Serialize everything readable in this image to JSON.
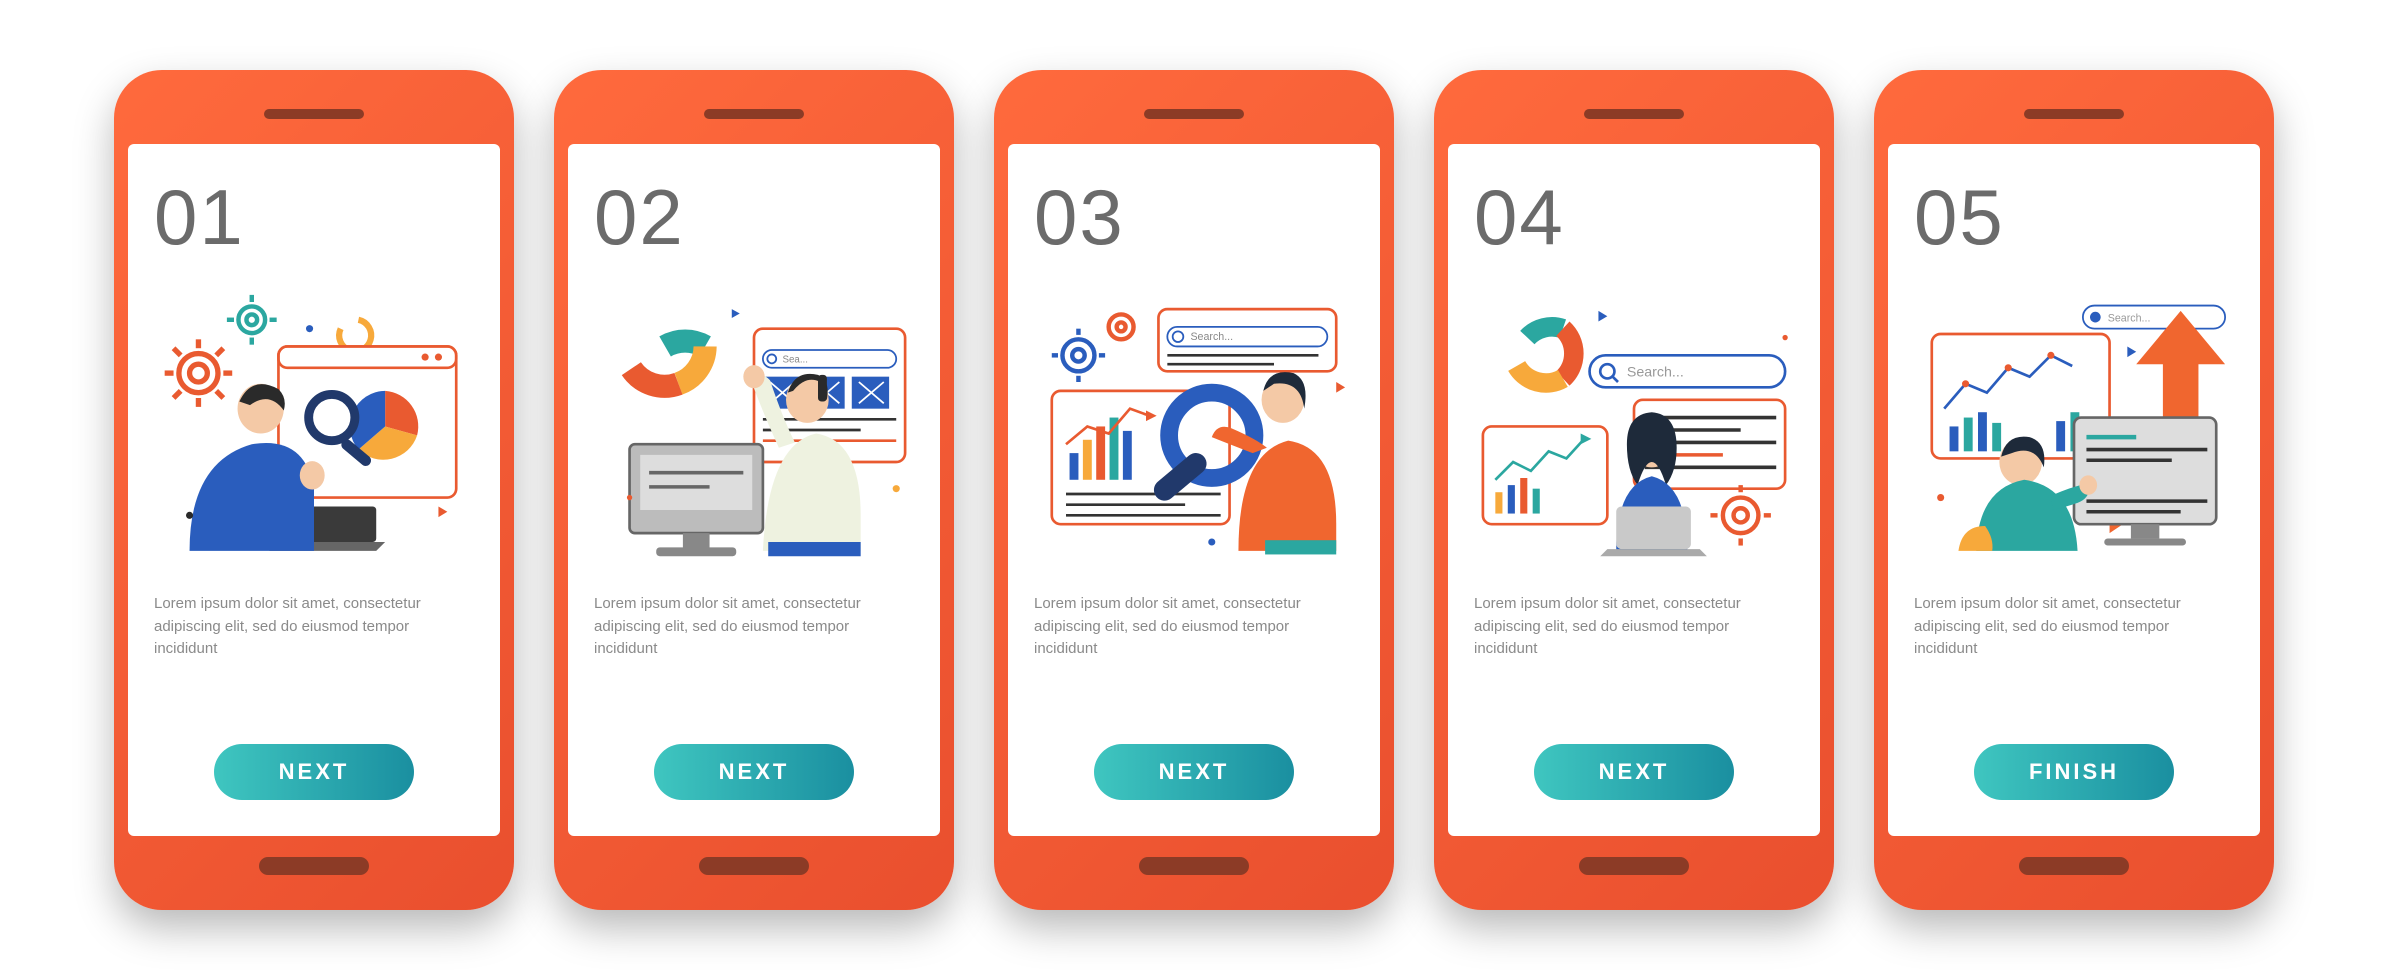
{
  "colors": {
    "phone_grad_a": "#ff6a3d",
    "phone_grad_b": "#e94f2e",
    "btn_grad_a": "#3fc6c0",
    "btn_grad_b": "#1a8fa0",
    "blue": "#2a5dbd",
    "teal": "#2ba7a0",
    "orange": "#f0662f",
    "amber": "#f7a93b"
  },
  "screens": [
    {
      "number": "01",
      "desc": "Lorem ipsum dolor sit amet, consectetur adipiscing elit, sed do eiusmod tempor incididunt",
      "button": "NEXT"
    },
    {
      "number": "02",
      "desc": "Lorem ipsum dolor sit amet, consectetur adipiscing elit, sed do eiusmod tempor incididunt",
      "button": "NEXT"
    },
    {
      "number": "03",
      "desc": "Lorem ipsum dolor sit amet, consectetur adipiscing elit, sed do eiusmod tempor incididunt",
      "button": "NEXT",
      "search_placeholder": "Search..."
    },
    {
      "number": "04",
      "desc": "Lorem ipsum dolor sit amet, consectetur adipiscing elit, sed do eiusmod tempor incididunt",
      "button": "NEXT",
      "search_placeholder": "Search..."
    },
    {
      "number": "05",
      "desc": "Lorem ipsum dolor sit amet, consectetur adipiscing elit, sed do eiusmod tempor incididunt",
      "button": "FINISH",
      "search_placeholder": "Search..."
    }
  ]
}
